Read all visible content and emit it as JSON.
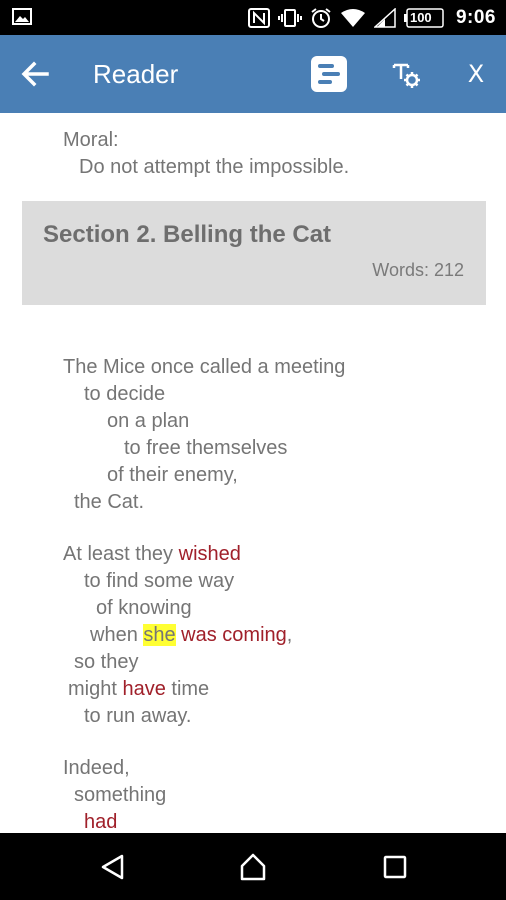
{
  "status_bar": {
    "time": "9:06",
    "battery": "100",
    "icons": [
      "image-icon",
      "nfc-icon",
      "vibrate-icon",
      "alarm-icon",
      "wifi-icon",
      "signal-icon",
      "battery-icon"
    ]
  },
  "app_bar": {
    "title": "Reader",
    "close_label": "X",
    "color": "#4a7fb5",
    "icons": [
      "back-arrow-icon",
      "table-of-contents-icon",
      "text-settings-icon"
    ]
  },
  "moral": {
    "label": "Moral:",
    "text": "Do not attempt the impossible."
  },
  "section": {
    "title": "Section 2. Belling the Cat",
    "words": "Words: 212"
  },
  "story": {
    "l1": "The Mice once called a meeting",
    "l2": "to decide",
    "l3": "on a plan",
    "l4": "to free themselves",
    "l5": "of their enemy,",
    "l6": "the Cat.",
    "l7a": "At least they ",
    "l7b": "wished",
    "l8": "to find some way",
    "l9": "of knowing",
    "l10a": "when ",
    "l10b": "she",
    "l10c": " was coming",
    "l10d": ",",
    "l11": "so they",
    "l12a": "might ",
    "l12b": "have",
    "l12c": " time",
    "l13": "to run away.",
    "l14": "Indeed,",
    "l15": "something",
    "l16": "had"
  },
  "colors": {
    "highlight_red": "#a0202a",
    "highlight_yellow": "#ffff33"
  },
  "nav_bar": {
    "icons": [
      "back-triangle-icon",
      "home-icon",
      "recents-icon"
    ]
  }
}
